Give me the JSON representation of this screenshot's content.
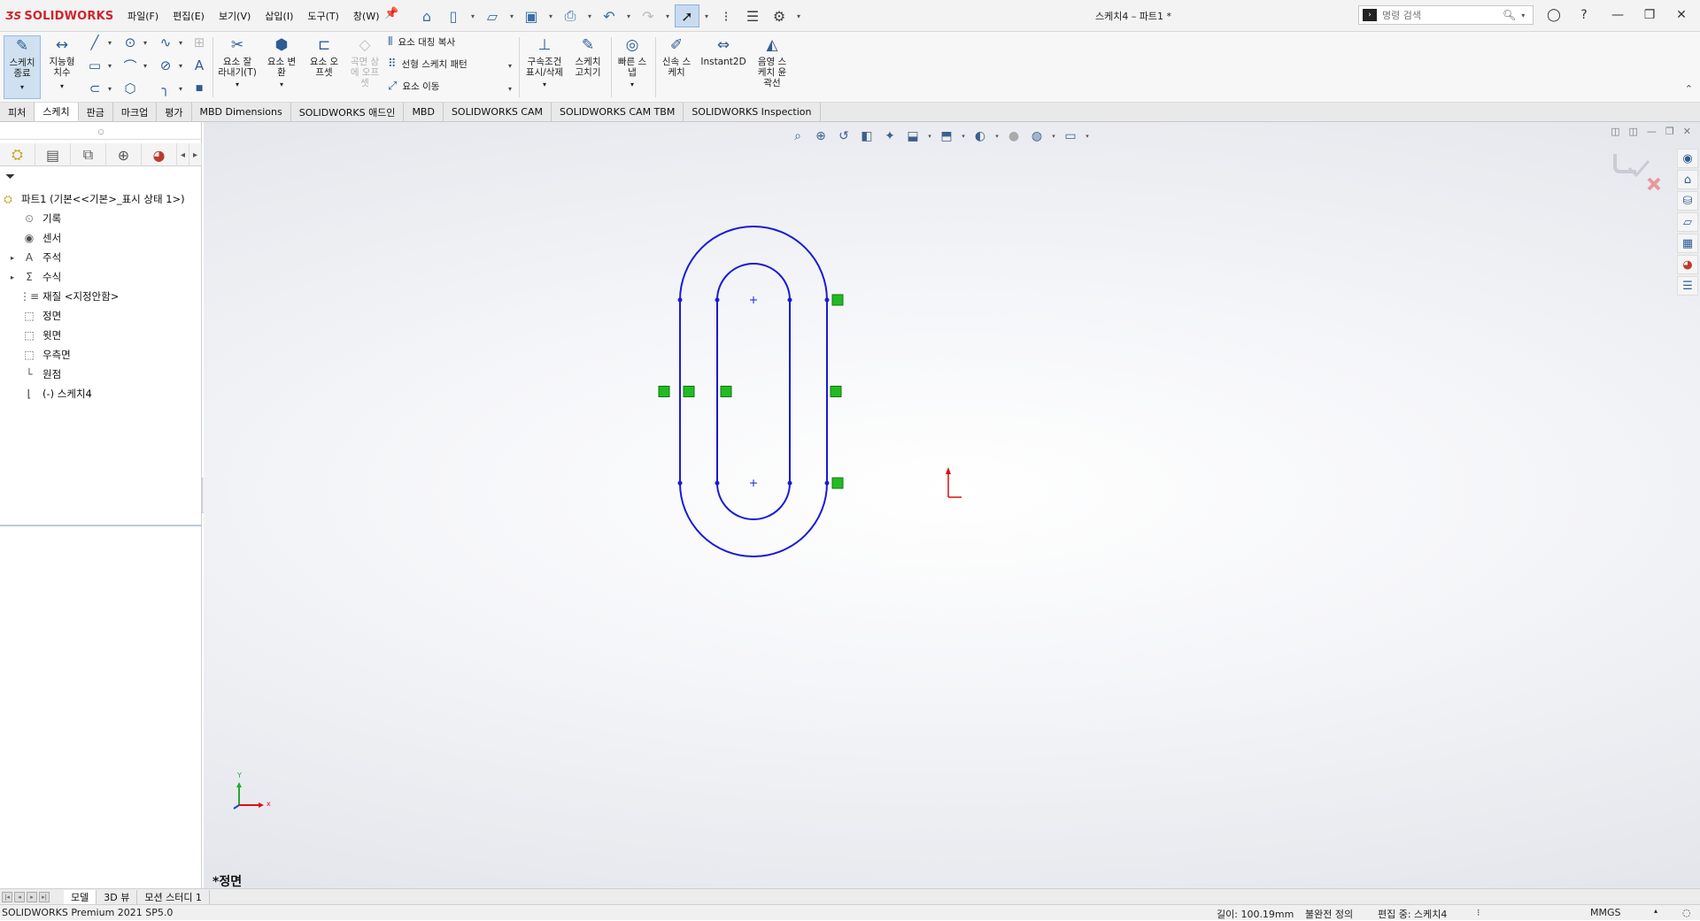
{
  "app": {
    "logo_text": "SOLIDWORKS",
    "title": "스케치4 – 파트1 *",
    "menus": [
      "파일(F)",
      "편집(E)",
      "보기(V)",
      "삽입(I)",
      "도구(T)",
      "창(W)"
    ],
    "search_placeholder": "명령 검색"
  },
  "ribbon": {
    "exit_sketch": "스케치\n종료",
    "smart_dimension": "지능형\n치수",
    "trim": "요소 잘\n라내기(T)",
    "convert": "요소 변\n환",
    "offset": "요소 오\n프셋",
    "surface_offset": "곡면 상\n에 오프\n셋",
    "mirror": "요소 대칭 복사",
    "linear_pattern": "선형 스케치 패턴",
    "move": "요소 이동",
    "relations": "구속조건\n표시/삭제",
    "repair": "스케치\n고치기",
    "quick_snaps": "빠른 스\n냅",
    "rapid_sketch": "신속 스\n케치",
    "instant2d": "Instant2D",
    "shaded_contours": "음영 스\n케치 윤\n곽선"
  },
  "tabs": [
    {
      "label": "피처",
      "active": false
    },
    {
      "label": "스케치",
      "active": true
    },
    {
      "label": "판금",
      "active": false
    },
    {
      "label": "마크업",
      "active": false
    },
    {
      "label": "평가",
      "active": false
    },
    {
      "label": "MBD Dimensions",
      "active": false
    },
    {
      "label": "SOLIDWORKS 애드인",
      "active": false
    },
    {
      "label": "MBD",
      "active": false
    },
    {
      "label": "SOLIDWORKS CAM",
      "active": false
    },
    {
      "label": "SOLIDWORKS CAM TBM",
      "active": false
    },
    {
      "label": "SOLIDWORKS Inspection",
      "active": false
    }
  ],
  "tree": [
    {
      "label": "파트1  (기본<<기본>_표시 상태 1>)",
      "icon": "part-icon",
      "expander": false,
      "indent": 0
    },
    {
      "label": "기록",
      "icon": "history-icon",
      "expander": false,
      "indent": 1
    },
    {
      "label": "센서",
      "icon": "sensor-icon",
      "expander": false,
      "indent": 1
    },
    {
      "label": "주석",
      "icon": "annotation-icon",
      "expander": true,
      "indent": 1
    },
    {
      "label": "수식",
      "icon": "equation-icon",
      "expander": true,
      "indent": 1
    },
    {
      "label": "재질 <지정안함>",
      "icon": "material-icon",
      "expander": false,
      "indent": 1
    },
    {
      "label": "정면",
      "icon": "plane-icon",
      "expander": false,
      "indent": 1
    },
    {
      "label": "윗면",
      "icon": "plane-icon",
      "expander": false,
      "indent": 1
    },
    {
      "label": "우측면",
      "icon": "plane-icon",
      "expander": false,
      "indent": 1
    },
    {
      "label": "원점",
      "icon": "origin-icon",
      "expander": false,
      "indent": 1
    },
    {
      "label": "(-) 스케치4",
      "icon": "sketch-icon",
      "expander": false,
      "indent": 1
    }
  ],
  "viewport": {
    "view_label": "*정면",
    "axis_x": "x",
    "axis_y": "Y"
  },
  "bottom_tabs": [
    {
      "label": "모델",
      "active": true
    },
    {
      "label": "3D 뷰",
      "active": false
    },
    {
      "label": "모션 스터디 1",
      "active": false
    }
  ],
  "status": {
    "version": "SOLIDWORKS Premium 2021 SP5.0",
    "length": "길이: 100.19mm",
    "definition": "불완전 정의",
    "editing": "편집 중: 스케치4",
    "units": "MMGS"
  },
  "colors": {
    "sketch_line": "#1a1ad6",
    "relation_badge": "#22bb22",
    "origin": "#dd1111",
    "brand": "#d0242b"
  }
}
